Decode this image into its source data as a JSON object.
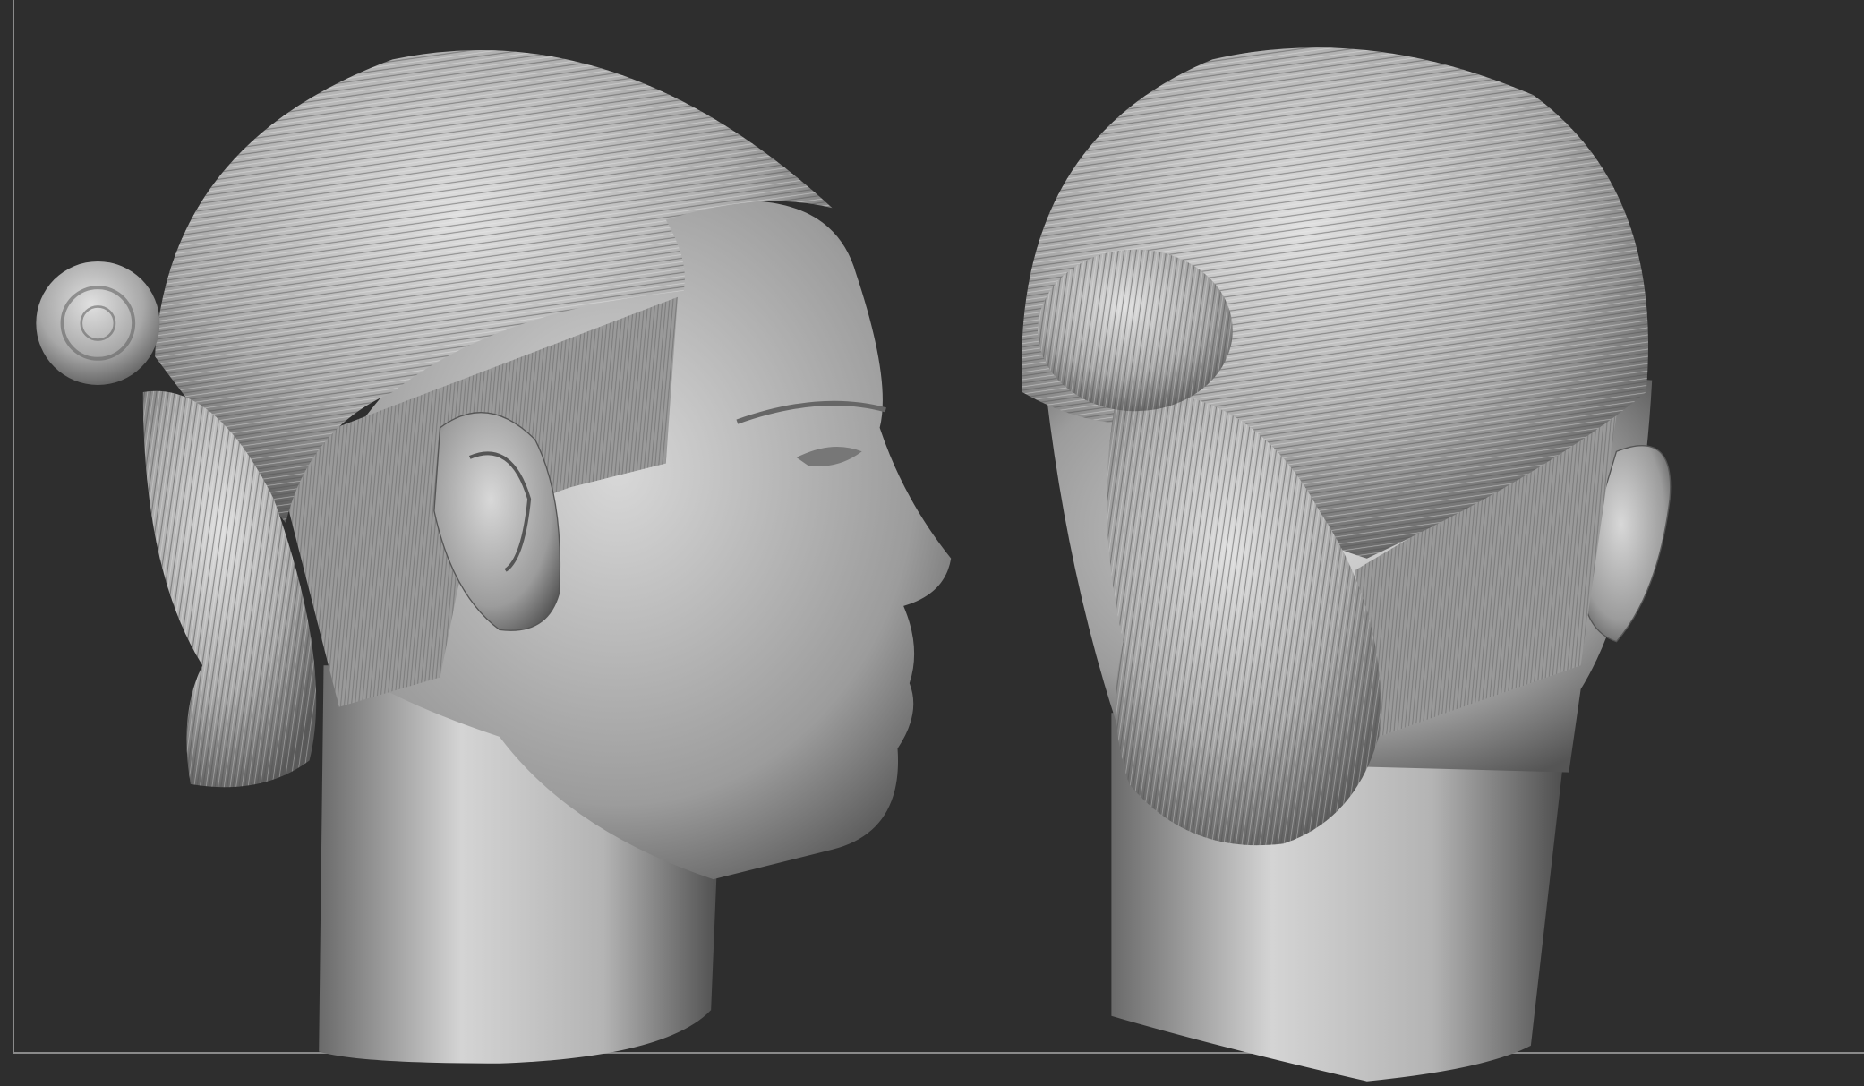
{
  "viewport": {
    "background_color": "#2e2e2e",
    "frame_line_color": "#8a8a8a",
    "material_color": "#c8c8c8"
  },
  "models": [
    {
      "view": "side-profile"
    },
    {
      "view": "back-three-quarter"
    }
  ]
}
